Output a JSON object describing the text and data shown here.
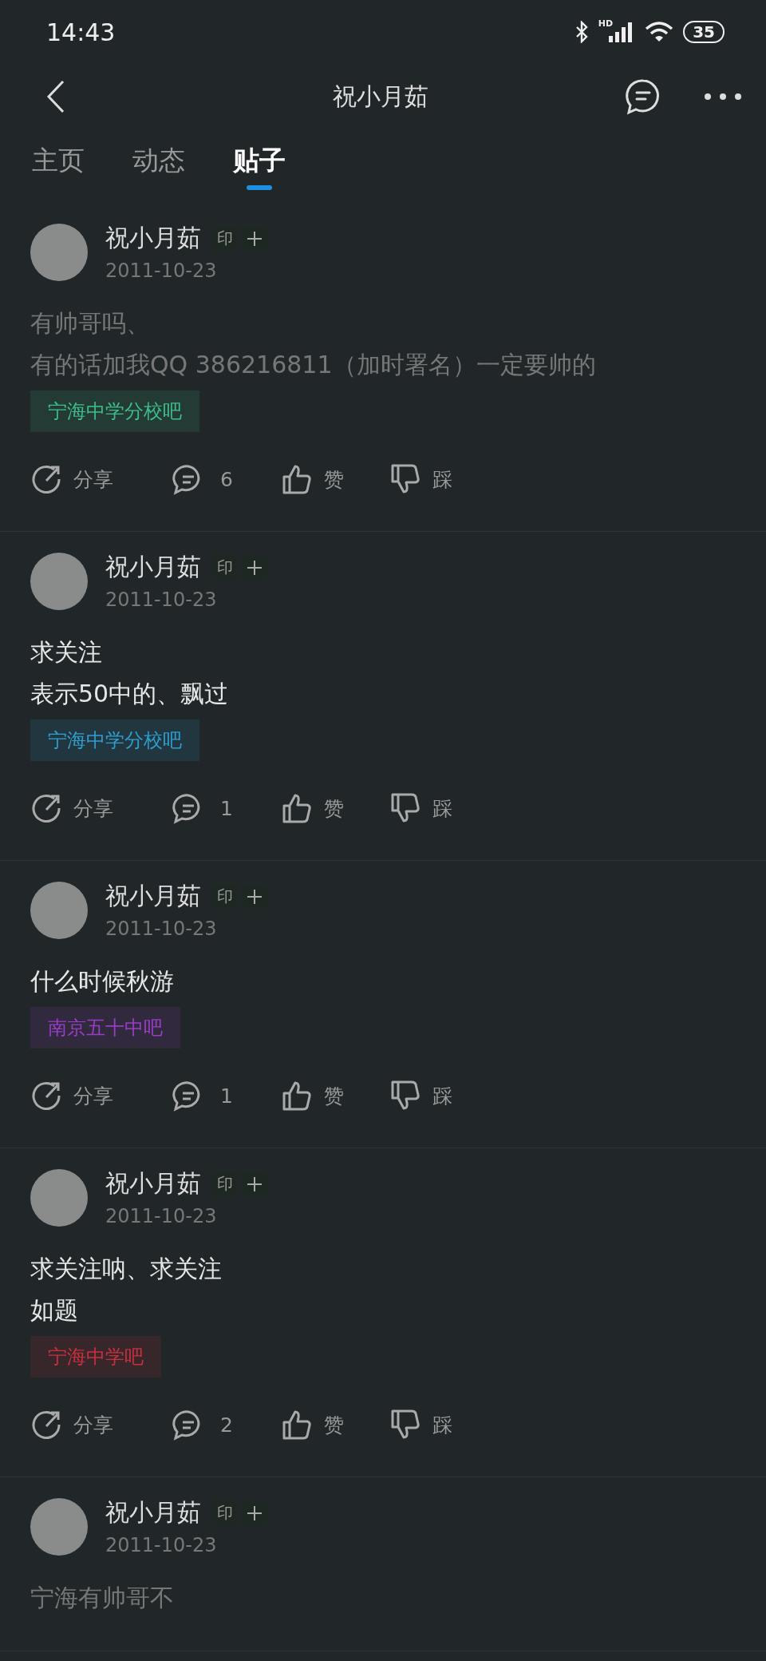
{
  "status_bar": {
    "time": "14:43",
    "network_label": "HD",
    "battery": "35"
  },
  "header": {
    "title": "祝小月茹"
  },
  "tabs": [
    {
      "label": "主页",
      "selected": false
    },
    {
      "label": "动态",
      "selected": false
    },
    {
      "label": "贴子",
      "selected": true
    }
  ],
  "posts": [
    {
      "author": "祝小月茹",
      "badge": "印",
      "date": "2011-10-23",
      "dimmed": true,
      "lines": [
        "有帅哥吗、",
        "有的话加我QQ 386216811（加时署名）一定要帅的"
      ],
      "forum": {
        "name": "宁海中学分校吧",
        "color": "#3cbf8a"
      },
      "share": "分享",
      "comments": "6",
      "like": "赞",
      "dislike": "踩"
    },
    {
      "author": "祝小月茹",
      "badge": "印",
      "date": "2011-10-23",
      "dimmed": false,
      "lines": [
        "求关注",
        "表示50中的、飘过"
      ],
      "forum": {
        "name": "宁海中学分校吧",
        "color": "#2e9ed0"
      },
      "share": "分享",
      "comments": "1",
      "like": "赞",
      "dislike": "踩"
    },
    {
      "author": "祝小月茹",
      "badge": "印",
      "date": "2011-10-23",
      "dimmed": false,
      "lines": [
        "什么时候秋游"
      ],
      "forum": {
        "name": "南京五十中吧",
        "color": "#9a3cc6"
      },
      "share": "分享",
      "comments": "1",
      "like": "赞",
      "dislike": "踩"
    },
    {
      "author": "祝小月茹",
      "badge": "印",
      "date": "2011-10-23",
      "dimmed": false,
      "lines": [
        "求关注呐、求关注",
        "如题"
      ],
      "forum": {
        "name": "宁海中学吧",
        "color": "#c8303c"
      },
      "share": "分享",
      "comments": "2",
      "like": "赞",
      "dislike": "踩"
    },
    {
      "author": "祝小月茹",
      "badge": "印",
      "date": "2011-10-23",
      "dimmed": true,
      "lines": [
        "宁海有帅哥不"
      ]
    }
  ]
}
